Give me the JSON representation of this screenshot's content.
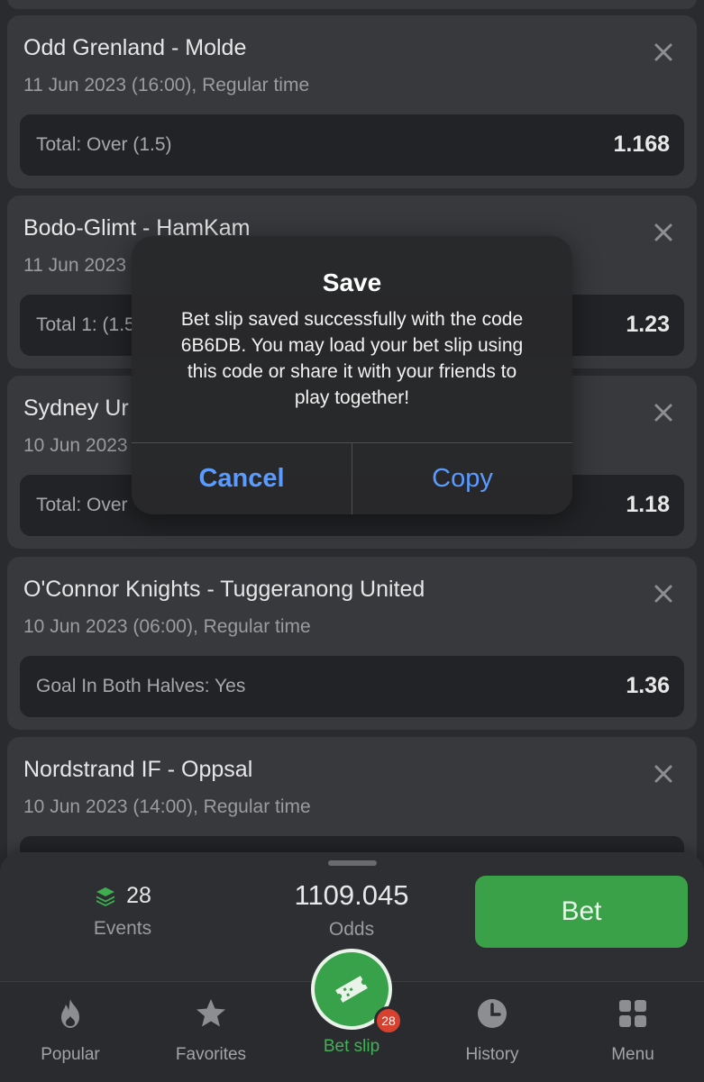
{
  "bets": [
    {
      "match": "Odd Grenland - Molde",
      "date": "11 Jun 2023 (16:00), Regular time",
      "selection": "Total: Over (1.5)",
      "odds": "1.168"
    },
    {
      "match": "Bodo-Glimt - HamKam",
      "date": "11 Jun 2023",
      "selection": "Total 1: (1.5",
      "odds": "1.23"
    },
    {
      "match": "Sydney Ur",
      "date": "10 Jun 2023",
      "selection": "Total: Over",
      "odds": "1.18"
    },
    {
      "match": "O'Connor Knights - Tuggeranong United",
      "date": "10 Jun 2023 (06:00), Regular time",
      "selection": "Goal In Both Halves: Yes",
      "odds": "1.36"
    },
    {
      "match": "Nordstrand IF - Oppsal",
      "date": "10 Jun 2023 (14:00), Regular time",
      "selection": "",
      "odds": ""
    }
  ],
  "dialog": {
    "title": "Save",
    "message": "Bet slip saved successfully with the code 6B6DB. You may load your bet slip using this code or share it with your friends to play together!",
    "cancel_label": "Cancel",
    "copy_label": "Copy"
  },
  "summary": {
    "events_count": "28",
    "events_label": "Events",
    "odds_value": "1109.045",
    "odds_label": "Odds",
    "bet_label": "Bet"
  },
  "tabs": {
    "popular": "Popular",
    "favorites": "Favorites",
    "betslip": "Bet slip",
    "betslip_badge": "28",
    "history": "History",
    "menu": "Menu"
  },
  "colors": {
    "accent_green": "#3aa148",
    "link_blue": "#5a9bff",
    "badge_red": "#d7412f"
  }
}
